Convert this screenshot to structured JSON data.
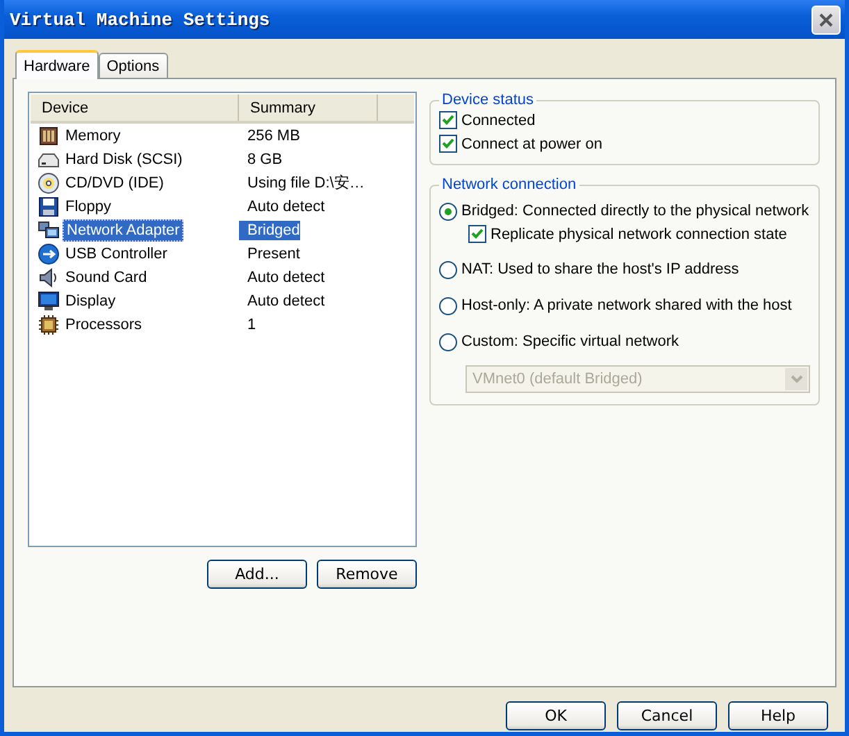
{
  "window": {
    "title": "Virtual Machine Settings"
  },
  "tabs": [
    {
      "label": "Hardware",
      "selected": true
    },
    {
      "label": "Options",
      "selected": false
    }
  ],
  "device_list": {
    "columns": [
      "Device",
      "Summary"
    ],
    "rows": [
      {
        "kind": "memory",
        "device": "Memory",
        "summary": "256 MB",
        "selected": false
      },
      {
        "kind": "disk",
        "device": "Hard Disk (SCSI)",
        "summary": "8 GB",
        "selected": false
      },
      {
        "kind": "cd",
        "device": "CD/DVD (IDE)",
        "summary": "Using file D:\\安…",
        "selected": false
      },
      {
        "kind": "floppy",
        "device": "Floppy",
        "summary": "Auto detect",
        "selected": false
      },
      {
        "kind": "network",
        "device": "Network Adapter",
        "summary": "Bridged",
        "selected": true
      },
      {
        "kind": "usb",
        "device": "USB Controller",
        "summary": "Present",
        "selected": false
      },
      {
        "kind": "sound",
        "device": "Sound Card",
        "summary": "Auto detect",
        "selected": false
      },
      {
        "kind": "display",
        "device": "Display",
        "summary": "Auto detect",
        "selected": false
      },
      {
        "kind": "cpu",
        "device": "Processors",
        "summary": "1",
        "selected": false
      }
    ]
  },
  "list_buttons": [
    "Add...",
    "Remove"
  ],
  "device_status": {
    "title": "Device status",
    "options": [
      {
        "label": "Connected",
        "checked": true
      },
      {
        "label": "Connect at power on",
        "checked": true
      }
    ]
  },
  "network_connection": {
    "title": "Network connection",
    "options": [
      {
        "kind": "radio",
        "label": "Bridged: Connected directly to the physical network",
        "selected": true
      },
      {
        "kind": "checkbox",
        "label": "Replicate physical network connection state",
        "checked": true
      },
      {
        "kind": "radio",
        "label": "NAT: Used to share the host's IP address",
        "selected": false
      },
      {
        "kind": "radio",
        "label": "Host-only: A private network shared with the host",
        "selected": false
      },
      {
        "kind": "radio",
        "label": "Custom: Specific virtual network",
        "selected": false
      },
      {
        "kind": "dropdown",
        "value": "VMnet0 (default Bridged)",
        "disabled": true
      }
    ]
  },
  "dialog_buttons": [
    "OK",
    "Cancel",
    "Help"
  ]
}
